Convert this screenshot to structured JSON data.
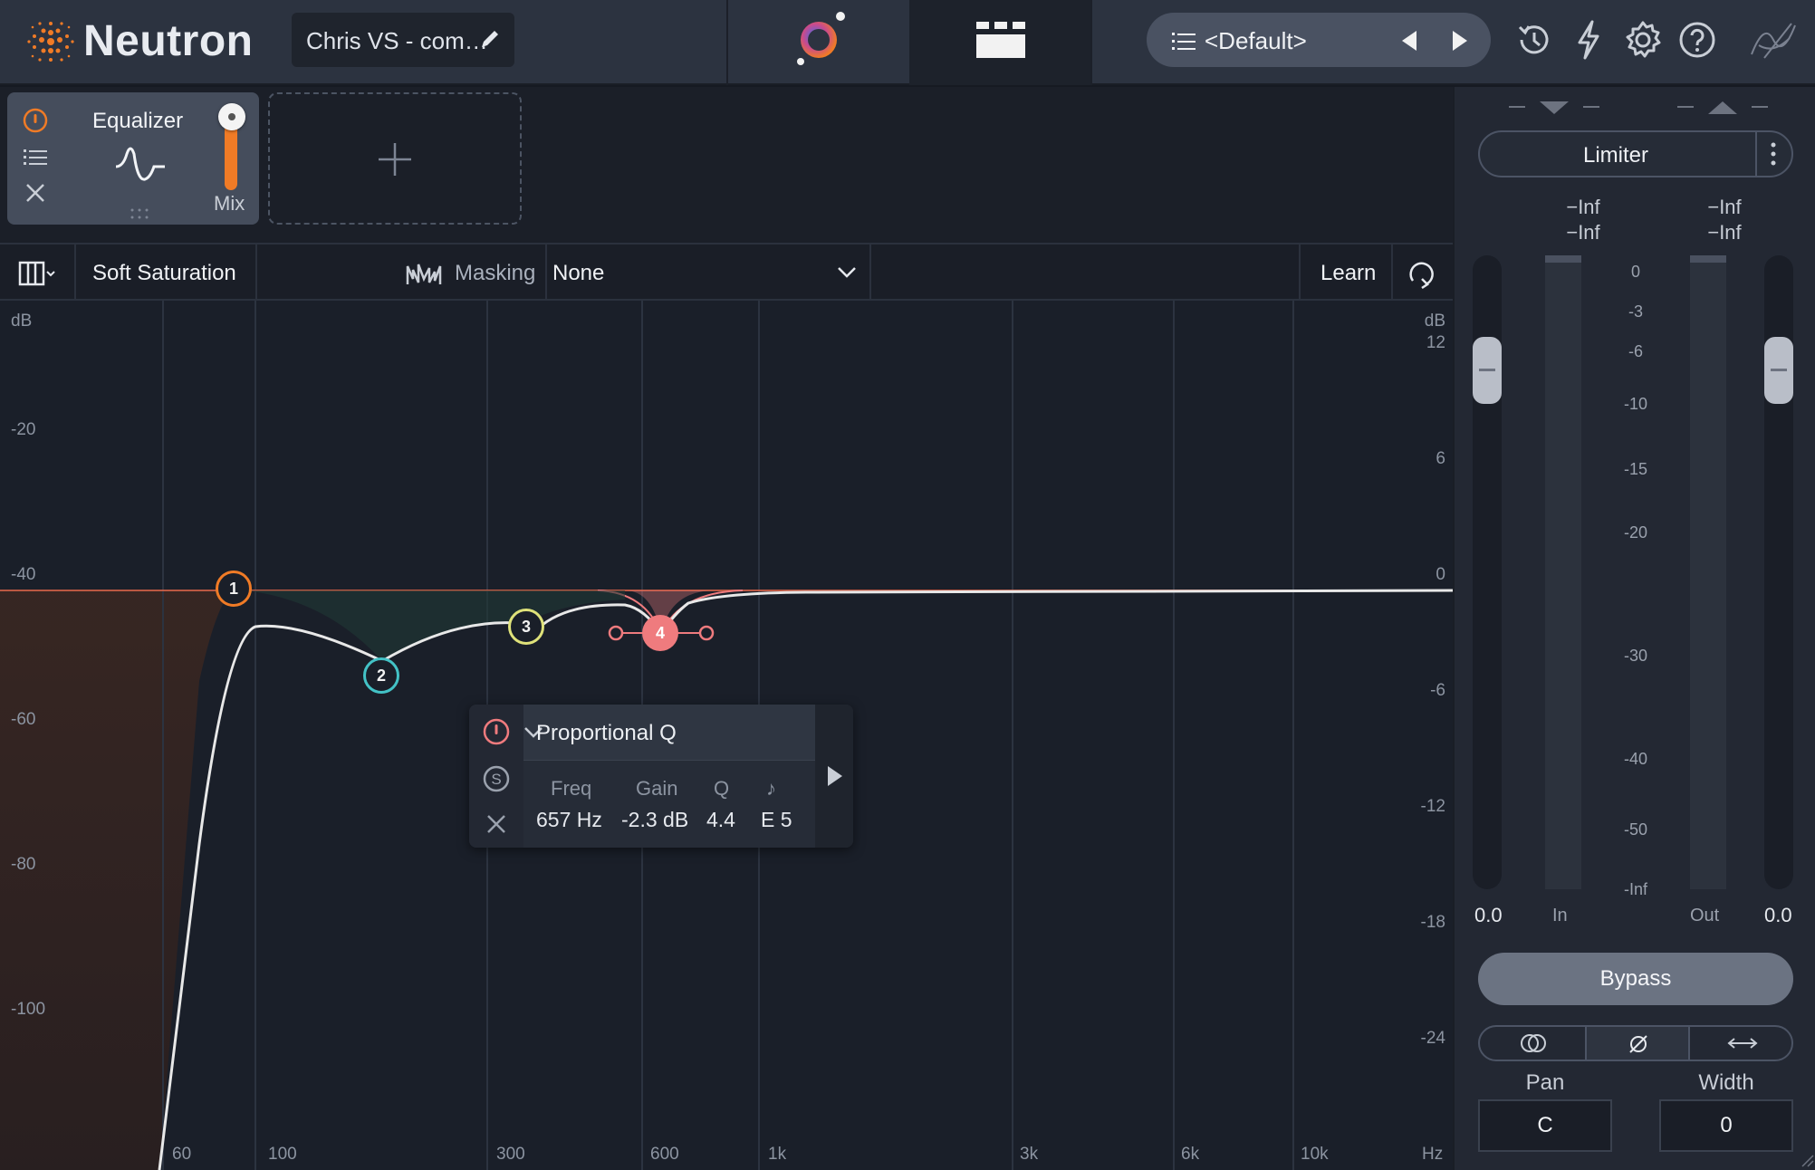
{
  "header": {
    "brand": "Neutron",
    "session_name": "Chris VS - com…",
    "preset_name": "<Default>"
  },
  "module": {
    "title": "Equalizer",
    "mix_label": "Mix",
    "mix_level": 1.0
  },
  "toolbar": {
    "saturation_label": "Soft Saturation",
    "masking_label": "Masking",
    "masking_select": "None",
    "learn_label": "Learn"
  },
  "graph": {
    "left_axis_unit": "dB",
    "left_axis_ticks": [
      "-20",
      "-40",
      "-60",
      "-80",
      "-100"
    ],
    "right_axis_unit": "dB",
    "right_axis_ticks": [
      "12",
      "6",
      "0",
      "-6",
      "-12",
      "-18",
      "-24"
    ],
    "freq_ticks": [
      "60",
      "100",
      "300",
      "600",
      "1k",
      "3k",
      "6k",
      "10k"
    ],
    "freq_unit": "Hz",
    "nodes": [
      {
        "id": "1",
        "color": "#f07b26"
      },
      {
        "id": "2",
        "color": "#43c2c6"
      },
      {
        "id": "3",
        "color": "#dfe27a"
      },
      {
        "id": "4",
        "color": "#ef7b7e"
      }
    ],
    "band_popup": {
      "mode": "Proportional Q",
      "headers": [
        "Freq",
        "Gain",
        "Q",
        "♪"
      ],
      "freq": "657 Hz",
      "gain": "-2.3 dB",
      "q": "4.4",
      "note": "E 5"
    }
  },
  "right_panel": {
    "module_name": "Limiter",
    "in_peak": "−Inf",
    "in_rms": "−Inf",
    "out_peak": "−Inf",
    "out_rms": "−Inf",
    "scale": [
      "0",
      "-3",
      "-6",
      "-10",
      "-15",
      "-20",
      "-30",
      "-40",
      "-50",
      "-Inf"
    ],
    "in_gain": "0.0",
    "out_gain": "0.0",
    "in_label": "In",
    "out_label": "Out",
    "bypass_label": "Bypass",
    "pan_label": "Pan",
    "pan_value": "C",
    "width_label": "Width",
    "width_value": "0"
  },
  "colors": {
    "accent": "#f07b26",
    "background": "#1a1f29",
    "curve": "#e6e6e6"
  }
}
